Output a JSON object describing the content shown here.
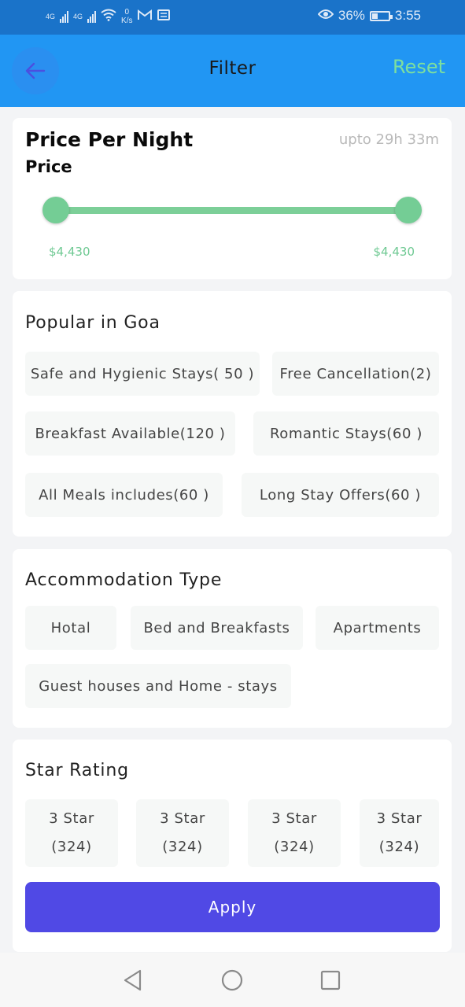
{
  "status_bar": {
    "net1": "4G",
    "net2": "4G",
    "speed_value": "0",
    "speed_unit": "K/s",
    "battery_percent": "36%",
    "battery_level": 0.36,
    "time": "3:55",
    "icons": [
      "signal-icon",
      "wifi-icon",
      "gmail-icon",
      "message-icon",
      "eye-icon",
      "battery-icon"
    ]
  },
  "appbar": {
    "title": "Filter",
    "reset_label": "Reset",
    "back_icon": "arrow-left-icon"
  },
  "price": {
    "title": "Price Per Night",
    "subtitle": "Price",
    "timer": "upto 29h 33m",
    "min_label": "$4,430",
    "max_label": "$4,430"
  },
  "popular": {
    "title": "Popular in Goa",
    "chips": [
      "Safe and Hygienic Stays( 50 )",
      "Free Cancellation(2)",
      "Breakfast Available(120 )",
      "Romantic Stays(60 )",
      "All Meals includes(60 )",
      "Long Stay Offers(60 )"
    ]
  },
  "accommodation": {
    "title": "Accommodation Type",
    "chips": [
      "Hotal",
      "Bed and Breakfasts",
      "Apartments",
      "Guest houses and Home - stays"
    ]
  },
  "star_rating": {
    "title": "Star Rating",
    "chips": [
      {
        "label": "3 Star",
        "count": "(324)"
      },
      {
        "label": "3 Star",
        "count": "(324)"
      },
      {
        "label": "3 Star",
        "count": "(324)"
      },
      {
        "label": "3 Star",
        "count": "(324)"
      }
    ]
  },
  "apply_label": "Apply",
  "colors": {
    "appbar": "#2196f3",
    "status_bar": "#1a73c9",
    "accent_green": "#74cd95",
    "apply_button": "#5049e5"
  },
  "navbar": {
    "icons": [
      "back-triangle-icon",
      "home-circle-icon",
      "recents-square-icon"
    ]
  }
}
